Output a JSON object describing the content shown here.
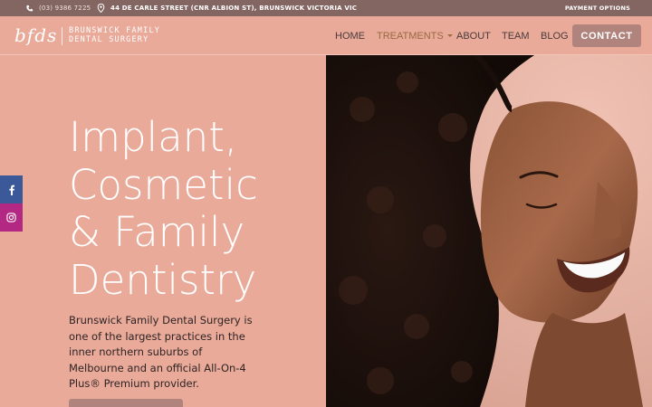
{
  "topbar": {
    "phone": "(03) 9386 7225",
    "address": "44 DE CARLE STREET (CNR ALBION ST), BRUNSWICK VICTORIA VIC",
    "payment": "PAYMENT OPTIONS"
  },
  "brand": {
    "mark": "bfds",
    "line1": "BRUNSWICK FAMILY",
    "line2": "DENTAL SURGERY"
  },
  "nav": {
    "home": "HOME",
    "treatments": "TREATMENTS",
    "about": "ABOUT",
    "team": "TEAM",
    "blog": "BLOG",
    "contact": "CONTACT"
  },
  "hero": {
    "title_lines": [
      "Implant,",
      "Cosmetic",
      "& Family",
      "Dentistry"
    ],
    "description": "Brunswick Family Dental Surgery is one of the largest practices in the inner northern suburbs of Melbourne and an official All-On-4 Plus® Premium provider."
  },
  "social": {
    "facebook_icon": "facebook-icon",
    "instagram_icon": "instagram-icon"
  },
  "colors": {
    "page_bg": "#e9aa9a",
    "topbar_bg": "#836562",
    "button_bg": "#b1837d",
    "facebook": "#3b5998",
    "instagram": "#b22882"
  }
}
